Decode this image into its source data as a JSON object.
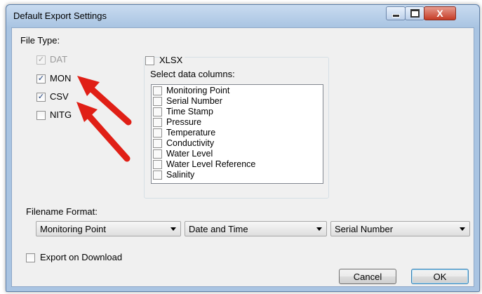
{
  "window": {
    "title": "Default Export Settings",
    "close_glyph": "X"
  },
  "file_type": {
    "label": "File Type:",
    "options": [
      {
        "label": "DAT",
        "checked": true,
        "disabled": true
      },
      {
        "label": "MON",
        "checked": true,
        "disabled": false
      },
      {
        "label": "CSV",
        "checked": true,
        "disabled": false
      },
      {
        "label": "NITG",
        "checked": false,
        "disabled": false
      }
    ]
  },
  "xlsx": {
    "label": "XLSX",
    "checked": false,
    "columns_label": "Select data columns:",
    "columns": [
      "Monitoring Point",
      "Serial Number",
      "Time Stamp",
      "Pressure",
      "Temperature",
      "Conductivity",
      "Water Level",
      "Water Level Reference",
      "Salinity"
    ]
  },
  "filename_format": {
    "label": "Filename Format:",
    "selects": [
      "Monitoring Point",
      "Date and Time",
      "Serial Number"
    ]
  },
  "export_on_download": {
    "label": "Export on Download",
    "checked": false
  },
  "buttons": {
    "cancel": "Cancel",
    "ok": "OK"
  },
  "annotation": {
    "arrow_color": "#e01f16"
  },
  "check_glyph": "✓"
}
